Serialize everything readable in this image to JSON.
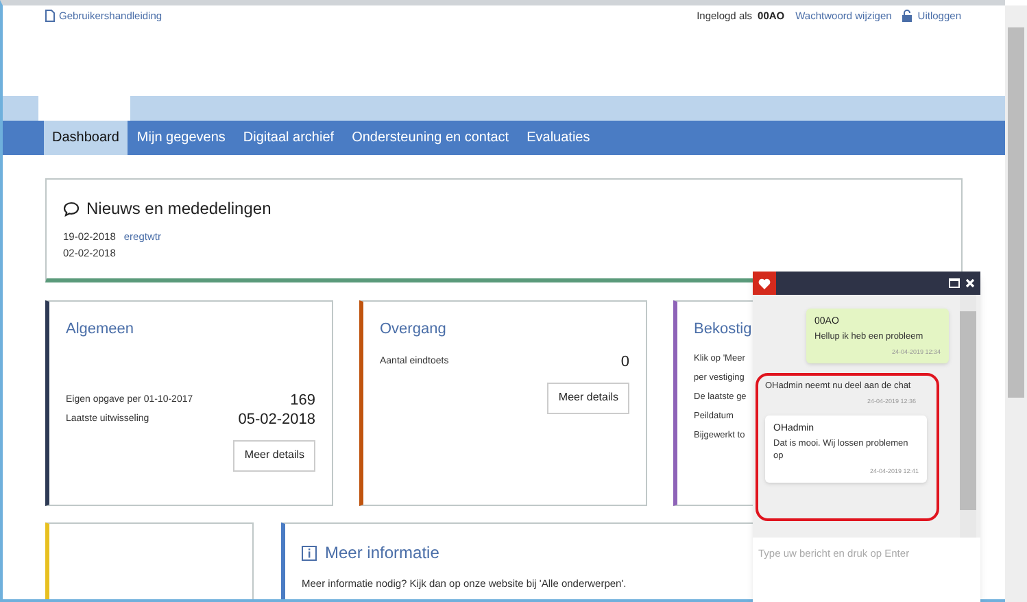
{
  "top_bar": {
    "manual_link": "Gebruikershandleiding",
    "logged_in_label": "Ingelogd als",
    "user": "00AO",
    "change_password": "Wachtwoord wijzigen",
    "logout": "Uitloggen"
  },
  "nav": [
    {
      "label": "Dashboard",
      "selected": true
    },
    {
      "label": "Mijn gegevens",
      "selected": false
    },
    {
      "label": "Digitaal archief",
      "selected": false
    },
    {
      "label": "Ondersteuning en contact",
      "selected": false
    },
    {
      "label": "Evaluaties",
      "selected": false
    }
  ],
  "news": {
    "title": "Nieuws en mededelingen",
    "items": [
      {
        "date": "19-02-2018",
        "link": "eregtwtr"
      },
      {
        "date": "02-02-2018"
      }
    ]
  },
  "cards": [
    {
      "title": "Algemeen",
      "color": "#2e3a55",
      "rows": [
        {
          "label": "Eigen opgave per 01-10-2017",
          "value": "169"
        },
        {
          "label": "Laatste uitwisseling",
          "value": "05-02-2018"
        }
      ],
      "button": "Meer details"
    },
    {
      "title": "Overgang",
      "color": "#c0540f",
      "rows": [
        {
          "label": "Aantal eindtoets",
          "value": "0"
        }
      ],
      "button": "Meer details"
    },
    {
      "title": "Bekostig",
      "color": "#8e63b8",
      "lines": [
        "Klik op 'Meer",
        "per vestiging",
        "De laatste ge",
        "Peildatum",
        "Bijgewerkt to"
      ]
    }
  ],
  "bottom_cards": [
    {
      "color": "#e8c020"
    },
    {
      "color": "#4a7cc4",
      "title": "Meer informatie",
      "text": "Meer informatie nodig? Kijk dan op onze website bij 'Alle onderwerpen'."
    }
  ],
  "chat": {
    "messages": [
      {
        "kind": "own",
        "sender": "00AO",
        "text": "Hellup ik heb een probleem",
        "time": "24-04-2019 12:34"
      },
      {
        "kind": "system",
        "text": "OHadmin neemt nu deel aan de chat",
        "time": "24-04-2019 12:36"
      },
      {
        "kind": "other",
        "sender": "OHadmin",
        "text": "Dat is mooi. Wij lossen problemen op",
        "time": "24-04-2019 12:41"
      }
    ],
    "placeholder": "Type uw bericht en druk op Enter"
  }
}
